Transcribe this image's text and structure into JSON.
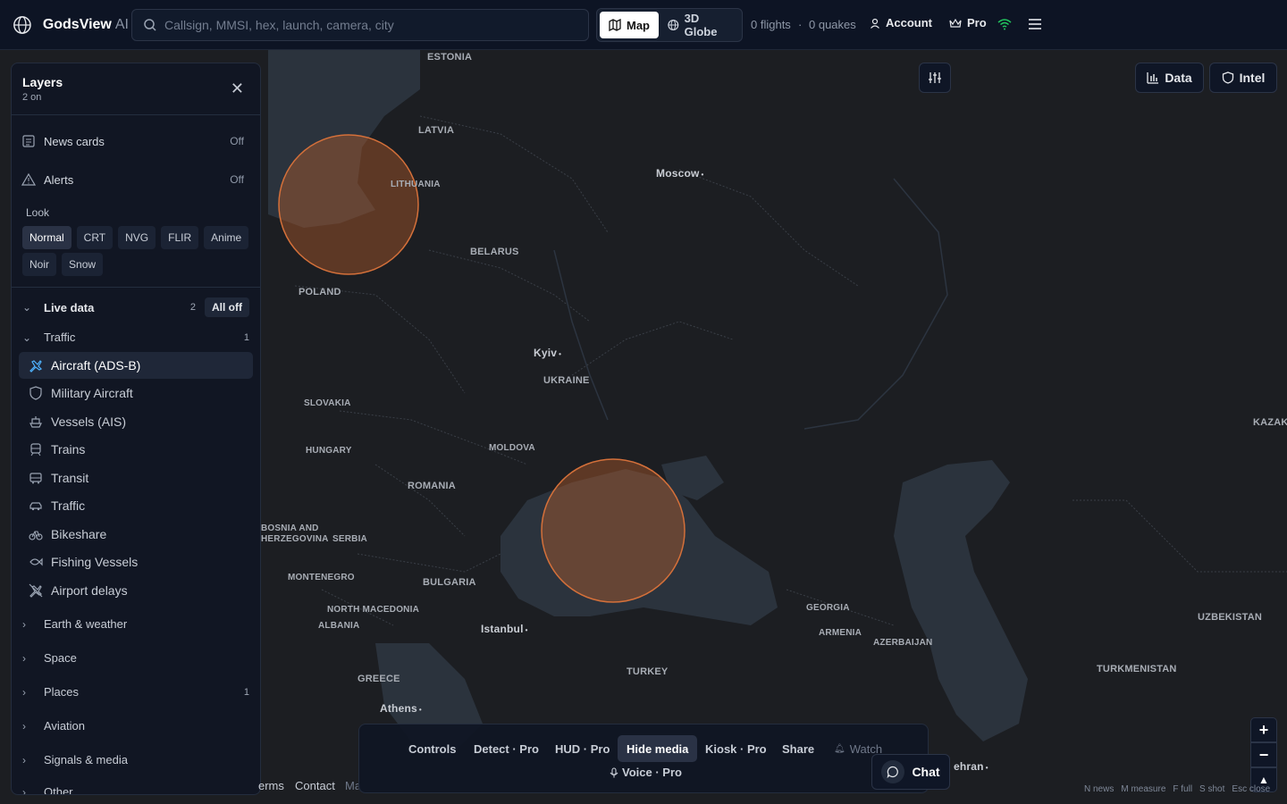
{
  "app": {
    "name": "GodsView",
    "suffix": "AI"
  },
  "search": {
    "placeholder": "Callsign, MMSI, hex, launch, camera, city"
  },
  "view_toggle": {
    "map": "Map",
    "globe": "3D Globe",
    "active": "Map"
  },
  "stats": {
    "flights": "0 flights",
    "separator": "·",
    "quakes": "0 quakes"
  },
  "top_nav": {
    "account": "Account",
    "pro": "Pro"
  },
  "panel": {
    "title": "Layers",
    "subtitle": "2 on",
    "news_cards": {
      "label": "News cards",
      "state": "Off"
    },
    "alerts": {
      "label": "Alerts",
      "state": "Off"
    },
    "look_header": "Look",
    "looks": [
      "Normal",
      "CRT",
      "NVG",
      "FLIR",
      "Anime",
      "Noir",
      "Snow"
    ],
    "active_look": "Normal",
    "live_data": {
      "label": "Live data",
      "count": "2",
      "all_off": "All off"
    },
    "traffic_group": {
      "label": "Traffic",
      "count": "1"
    },
    "layers": [
      {
        "label": "Aircraft (ADS-B)",
        "icon": "plane-icon",
        "active": true
      },
      {
        "label": "Military Aircraft",
        "icon": "shield-icon",
        "active": false
      },
      {
        "label": "Vessels (AIS)",
        "icon": "ship-icon",
        "active": false
      },
      {
        "label": "Trains",
        "icon": "train-icon",
        "active": false
      },
      {
        "label": "Transit",
        "icon": "bus-icon",
        "active": false
      },
      {
        "label": "Traffic",
        "icon": "car-icon",
        "active": false
      },
      {
        "label": "Bikeshare",
        "icon": "bike-icon",
        "active": false
      },
      {
        "label": "Fishing Vessels",
        "icon": "fish-icon",
        "active": false
      },
      {
        "label": "Airport delays",
        "icon": "plane-off-icon",
        "active": false
      }
    ],
    "groups": [
      {
        "label": "Earth & weather",
        "count": ""
      },
      {
        "label": "Space",
        "count": ""
      },
      {
        "label": "Places",
        "count": "1"
      },
      {
        "label": "Aviation",
        "count": ""
      },
      {
        "label": "Signals & media",
        "count": ""
      },
      {
        "label": "Other",
        "count": ""
      }
    ]
  },
  "right_buttons": {
    "data": "Data",
    "intel": "Intel"
  },
  "bottom_bar": {
    "items": [
      "Controls",
      "Detect · Pro",
      "HUD · Pro",
      "Hide media",
      "Kiosk · Pro",
      "Share",
      "Watch"
    ],
    "active": "Hide media",
    "voice": "Voice · Pro"
  },
  "chat": {
    "label": "Chat"
  },
  "footer": {
    "terms": "erms",
    "contact": "Contact",
    "ma": "Ma"
  },
  "hints": [
    "N news",
    "M measure",
    "F full",
    "S shot",
    "Esc close"
  ],
  "map_labels": {
    "countries": [
      "ESTONIA",
      "LATVIA",
      "LITHUANIA",
      "BELARUS",
      "POLAND",
      "UKRAINE",
      "SLOVAKIA",
      "HUNGARY",
      "MOLDOVA",
      "ROMANIA",
      "BOSNIA AND HERZEGOVINA",
      "SERBIA",
      "MONTENEGRO",
      "BULGARIA",
      "NORTH MACEDONIA",
      "ALBANIA",
      "GREECE",
      "TURKEY",
      "GEORGIA",
      "ARMENIA",
      "AZERBAIJAN",
      "UZBEKISTAN",
      "TURKMENISTAN",
      "KAZAK"
    ],
    "cities": [
      "Moscow",
      "Kyiv",
      "Istanbul",
      "Athens",
      "ehran"
    ]
  },
  "colors": {
    "accent": "#4fb3ff",
    "hotspot": "#c8642a",
    "wifi": "#22c55e"
  }
}
